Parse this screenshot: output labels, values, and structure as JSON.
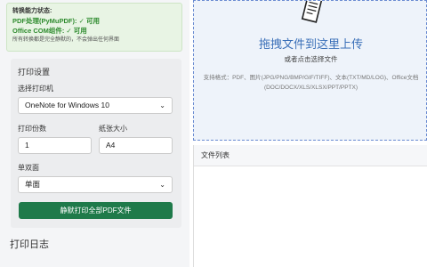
{
  "status": {
    "title": "转换能力状态:",
    "pdf_line": "PDF处理(PyMuPDF): ✓ 可用",
    "office_line": "Office COM组件: ✓ 可用",
    "note": "所有转换都是完全静默的，不会弹出任何界面"
  },
  "settings": {
    "heading": "打印设置",
    "printer_label": "选择打印机",
    "printer_value": "OneNote for Windows 10",
    "copies_label": "打印份数",
    "copies_value": "1",
    "paper_label": "纸张大小",
    "paper_value": "A4",
    "duplex_label": "单双面",
    "duplex_value": "单面",
    "print_button": "静默打印全部PDF文件"
  },
  "log": {
    "title": "打印日志"
  },
  "dropzone": {
    "icon": "document-icon",
    "main": "拖拽文件到这里上传",
    "sub": "或者点击选择文件",
    "formats": "支持格式：PDF、图片(JPG/PNG/BMP/GIF/TIFF)、文本(TXT/MD/LOG)、Office文档(DOC/DOCX/XLS/XLSX/PPT/PPTX)"
  },
  "filelist": {
    "title": "文件列表"
  },
  "colors": {
    "accent": "#1f7a4a",
    "ok": "#2e8b2e",
    "drop_border": "#6a8bd1",
    "drop_text": "#3a6fb8"
  }
}
